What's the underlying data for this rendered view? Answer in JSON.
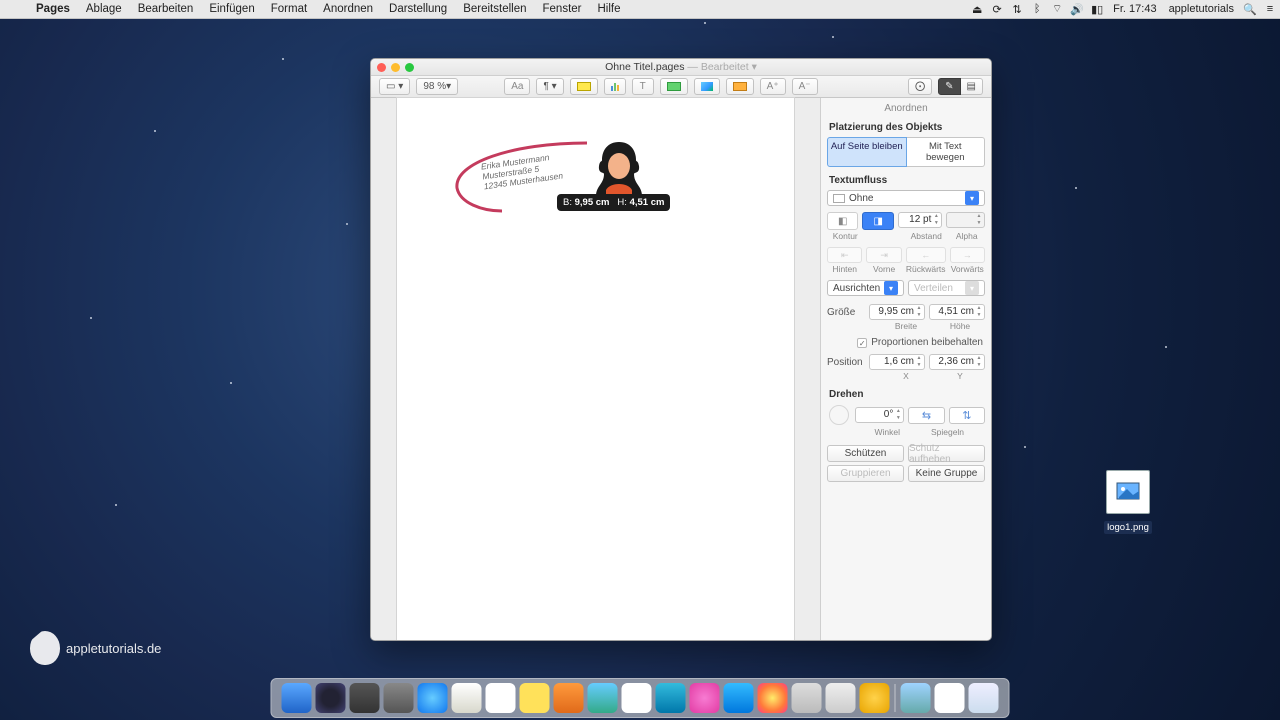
{
  "menubar": {
    "appname": "Pages",
    "items": [
      "Ablage",
      "Bearbeiten",
      "Einfügen",
      "Format",
      "Anordnen",
      "Darstellung",
      "Bereitstellen",
      "Fenster",
      "Hilfe"
    ],
    "clock": "Fr. 17:43",
    "user": "appletutorials"
  },
  "window": {
    "filename": "Ohne Titel.pages",
    "status": "— Bearbeitet",
    "zoom": "98 %"
  },
  "document_object": {
    "name_line1": "Erika Mustermann",
    "name_line2": "Musterstraße 5",
    "name_line3": "12345 Musterhausen",
    "tooltip_w_label": "B:",
    "tooltip_w_val": "9,95 cm",
    "tooltip_h_label": "H:",
    "tooltip_h_val": "4,51 cm"
  },
  "inspector": {
    "title": "Anordnen",
    "placement_header": "Platzierung des Objekts",
    "placement_opt1": "Auf Seite bleiben",
    "placement_opt2": "Mit Text bewegen",
    "wrap_header": "Textumfluss",
    "wrap_value": "Ohne",
    "spacing_value": "12 pt",
    "lbl_kontur": "Kontur",
    "lbl_abstand": "Abstand",
    "lbl_alpha": "Alpha",
    "order_hinten": "Hinten",
    "order_vorne": "Vorne",
    "order_ruck": "Rückwärts",
    "order_vor": "Vorwärts",
    "align_label": "Ausrichten",
    "distribute_label": "Verteilen",
    "size_label": "Größe",
    "size_w": "9,95 cm",
    "size_h": "4,51 cm",
    "size_w_lbl": "Breite",
    "size_h_lbl": "Höhe",
    "proportions": "Proportionen beibehalten",
    "pos_label": "Position",
    "pos_x": "1,6 cm",
    "pos_y": "2,36 cm",
    "pos_x_lbl": "X",
    "pos_y_lbl": "Y",
    "rotate_header": "Drehen",
    "angle_val": "0°",
    "angle_lbl": "Winkel",
    "flip_lbl": "Spiegeln",
    "protect": "Schützen",
    "unprotect": "Schutz aufheben",
    "group": "Gruppieren",
    "ungroup": "Keine Gruppe"
  },
  "desktop_file": "logo1.png",
  "watermark": "appletutorials.de"
}
